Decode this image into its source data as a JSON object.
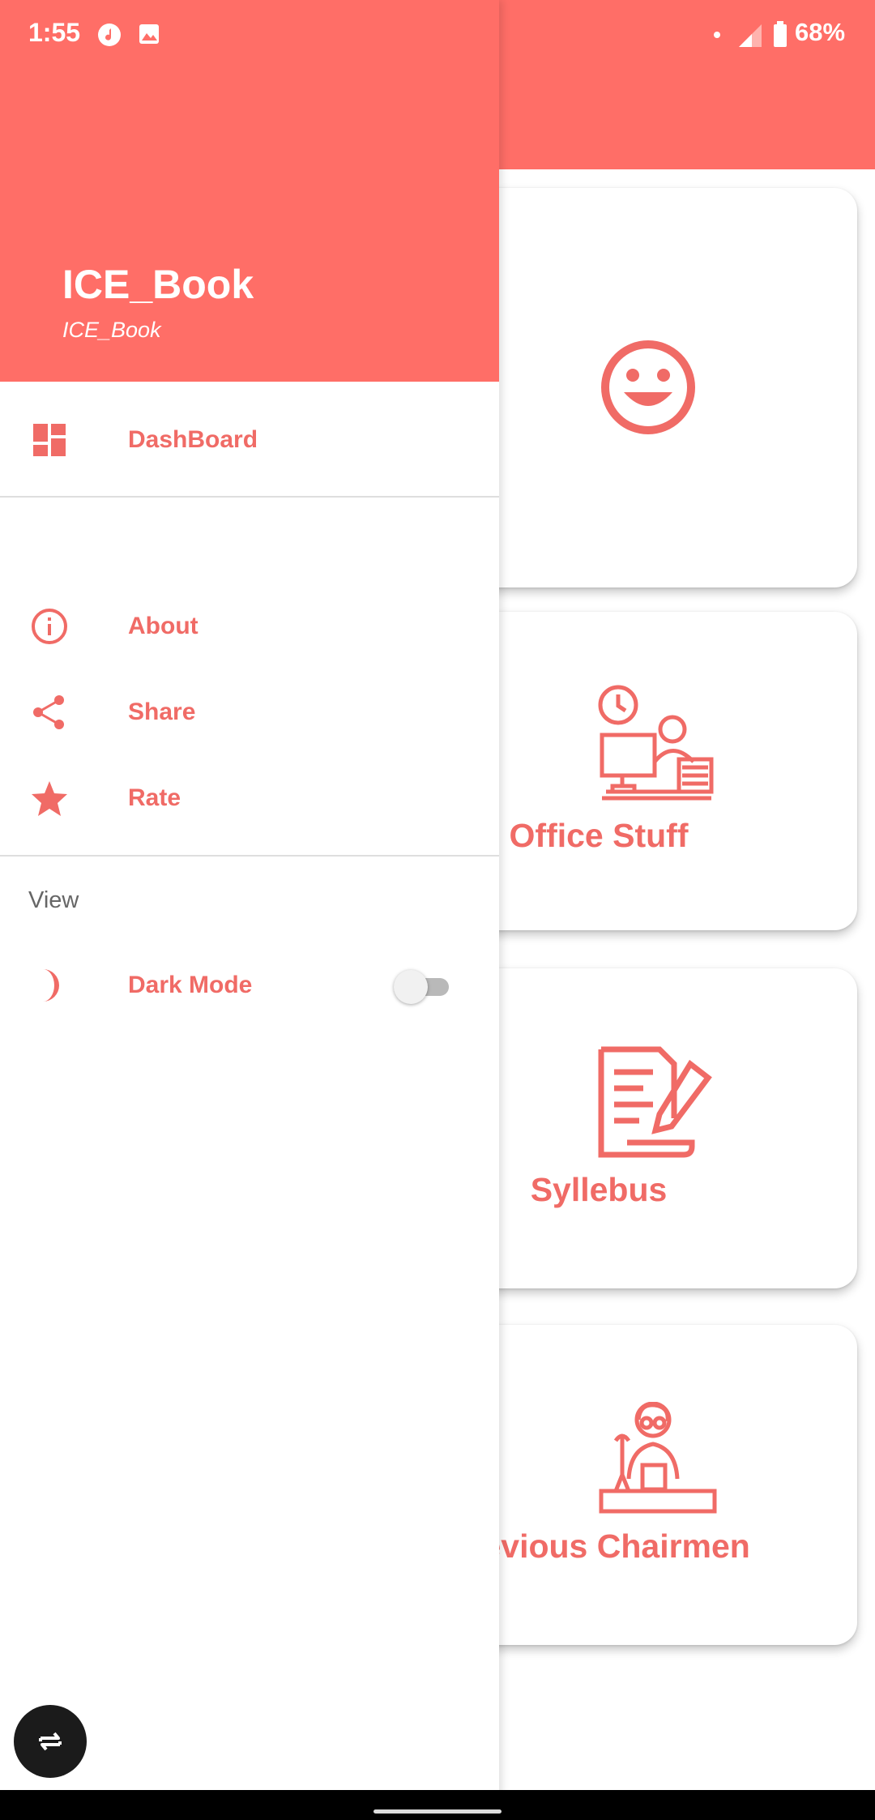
{
  "status_bar": {
    "time": "1:55",
    "battery": "68%",
    "icons": [
      "music-note-icon",
      "image-icon",
      "dot-icon",
      "signal-icon",
      "battery-icon"
    ]
  },
  "drawer": {
    "title": "ICE_Book",
    "subtitle": "ICE_Book",
    "items": [
      {
        "label": "DashBoard",
        "icon": "dashboard-icon"
      },
      {
        "label": "About",
        "icon": "info-icon"
      },
      {
        "label": "Share",
        "icon": "share-icon"
      },
      {
        "label": "Rate",
        "icon": "star-icon"
      }
    ],
    "view_section": {
      "label": "View",
      "dark_mode_label": "Dark Mode",
      "dark_mode_icon": "moon-icon",
      "dark_mode_enabled": false
    }
  },
  "cards": [
    {
      "label": "",
      "icon": "smiley-icon"
    },
    {
      "label": "Office Stuff",
      "icon": "office-worker-icon"
    },
    {
      "label": "Syllebus",
      "icon": "document-pen-icon"
    },
    {
      "label": "Previous Chairmen",
      "icon": "speaker-podium-icon"
    }
  ],
  "colors": {
    "accent": "#ff6e67",
    "accent_text": "#f06b66",
    "background": "#ffffff"
  },
  "floating_button": {
    "icon": "rotate-icon"
  }
}
